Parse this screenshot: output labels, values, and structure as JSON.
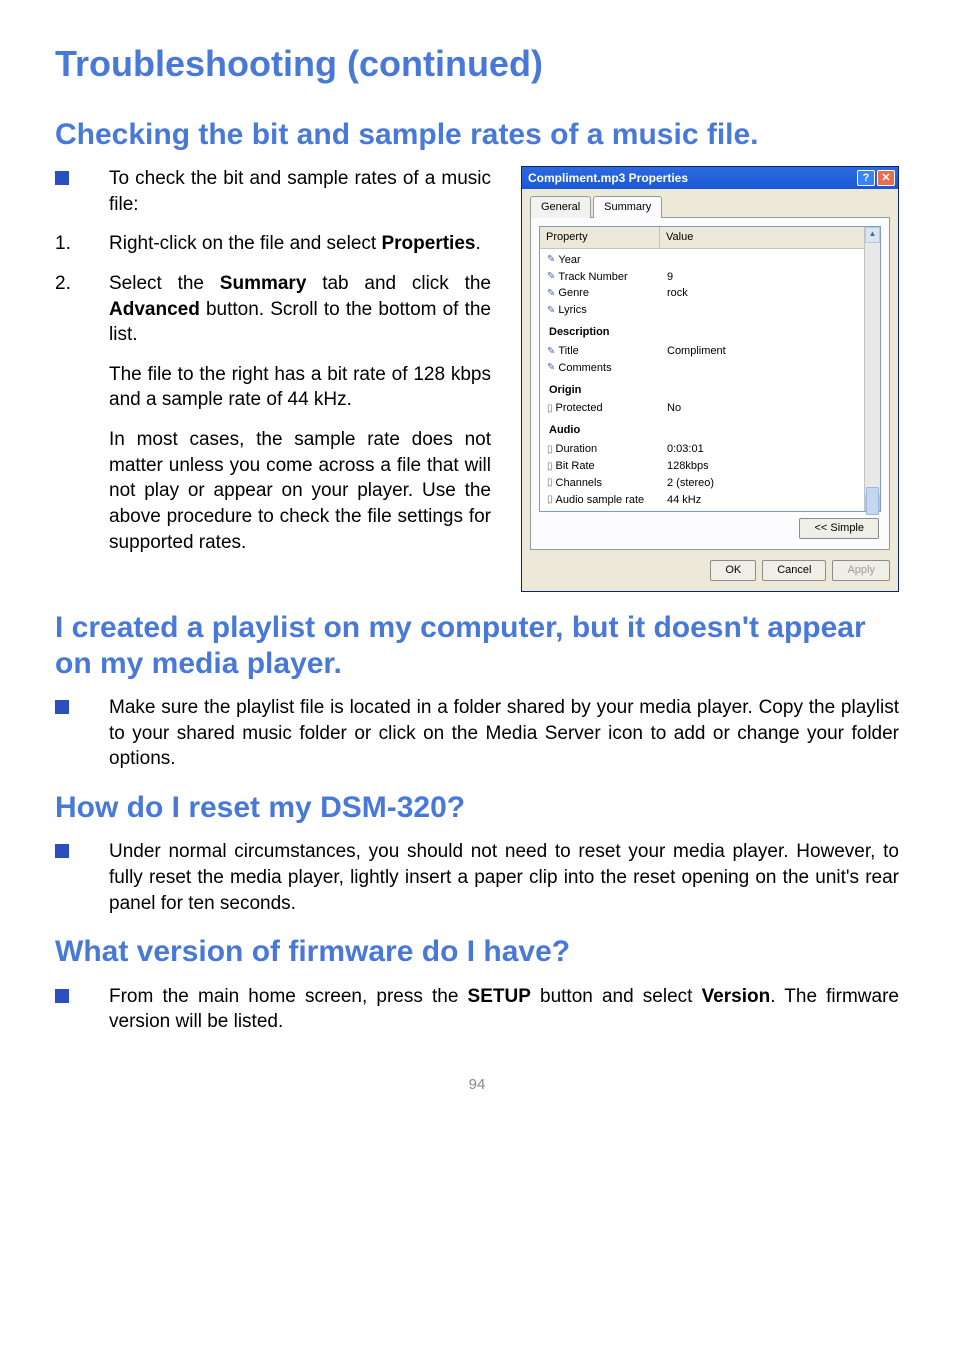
{
  "page_number": "94",
  "h1": "Troubleshooting (continued)",
  "section1": {
    "heading": "Checking the bit and sample rates of a music file.",
    "intro": "To check the bit and sample rates of a music file:",
    "step1_num": "1.",
    "step1_a": "Right-click on the file and select ",
    "step1_bold": "Properties",
    "step1_b": ".",
    "step2_num": "2.",
    "step2_a": "Select the ",
    "step2_bold1": "Summary",
    "step2_b": " tab and click the ",
    "step2_bold2": "Advanced",
    "step2_c": " button. Scroll to the bottom of the list.",
    "para2": "The file to the right has a bit rate of 128 kbps and a sample rate of 44 kHz.",
    "para3": "In most cases, the sample rate does not matter unless you come across a file that will not play or appear on your player. Use the above procedure to check the file settings for supported rates."
  },
  "section2": {
    "heading": "I created a playlist on my computer, but it doesn't appear on my media player.",
    "body": "Make sure the playlist file is located in a folder shared by your media player. Copy the playlist to your shared music folder or click on the Media Server icon to add or change your folder options."
  },
  "section3": {
    "heading": "How do I reset my DSM-320?",
    "body": "Under normal circumstances, you should not need to reset your media player. However, to fully reset the media player, lightly insert a paper clip into the reset opening on the unit's rear panel for ten seconds."
  },
  "section4": {
    "heading": "What version of firmware do I have?",
    "body_a": "From the main home screen, press the ",
    "body_bold1": "SETUP",
    "body_b": " button and select ",
    "body_bold2": "Version",
    "body_c": ". The firmware version will be listed."
  },
  "dialog": {
    "title": "Compliment.mp3 Properties",
    "tabs": {
      "general": "General",
      "summary": "Summary"
    },
    "list_header": {
      "property": "Property",
      "value": "Value"
    },
    "rows": {
      "year": "Year",
      "track_number": "Track Number",
      "track_number_val": "9",
      "genre": "Genre",
      "genre_val": "rock",
      "lyrics": "Lyrics",
      "group_description": "Description",
      "title": "Title",
      "title_val": "Compliment",
      "comments": "Comments",
      "group_origin": "Origin",
      "protected": "Protected",
      "protected_val": "No",
      "group_audio": "Audio",
      "duration": "Duration",
      "duration_val": "0:03:01",
      "bit_rate": "Bit Rate",
      "bit_rate_val": "128kbps",
      "channels": "Channels",
      "channels_val": "2 (stereo)",
      "sample_rate": "Audio sample rate",
      "sample_rate_val": "44 kHz"
    },
    "simple_button": "<< Simple",
    "buttons": {
      "ok": "OK",
      "cancel": "Cancel",
      "apply": "Apply"
    }
  }
}
